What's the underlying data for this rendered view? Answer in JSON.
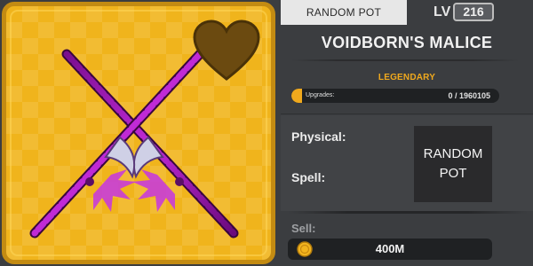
{
  "item": {
    "icons": {
      "favorite": "heart-icon",
      "weapon": "crossed-swords-art"
    },
    "colors": {
      "card_bg": "#f0b41c",
      "card_border": "#c38b12",
      "heart": "#6b4a10",
      "blade": "#b020c8"
    }
  },
  "header": {
    "pot_tab_label": "RANDOM POT",
    "level_label": "LV",
    "level_value": "216"
  },
  "title": {
    "name": "VOIDBORN'S MALICE"
  },
  "rarity": {
    "label": "LEGENDARY",
    "color": "#f0a91d"
  },
  "upgrades": {
    "label": "Upgrades:",
    "value_text": "0 / 1960105",
    "current": 0,
    "max": 1960105
  },
  "stats": {
    "physical_label": "Physical:",
    "spell_label": "Spell:"
  },
  "pot_box": {
    "line1": "RANDOM",
    "line2": "POT"
  },
  "sell": {
    "label": "Sell:",
    "value": "400M",
    "icon": "coin-icon"
  }
}
